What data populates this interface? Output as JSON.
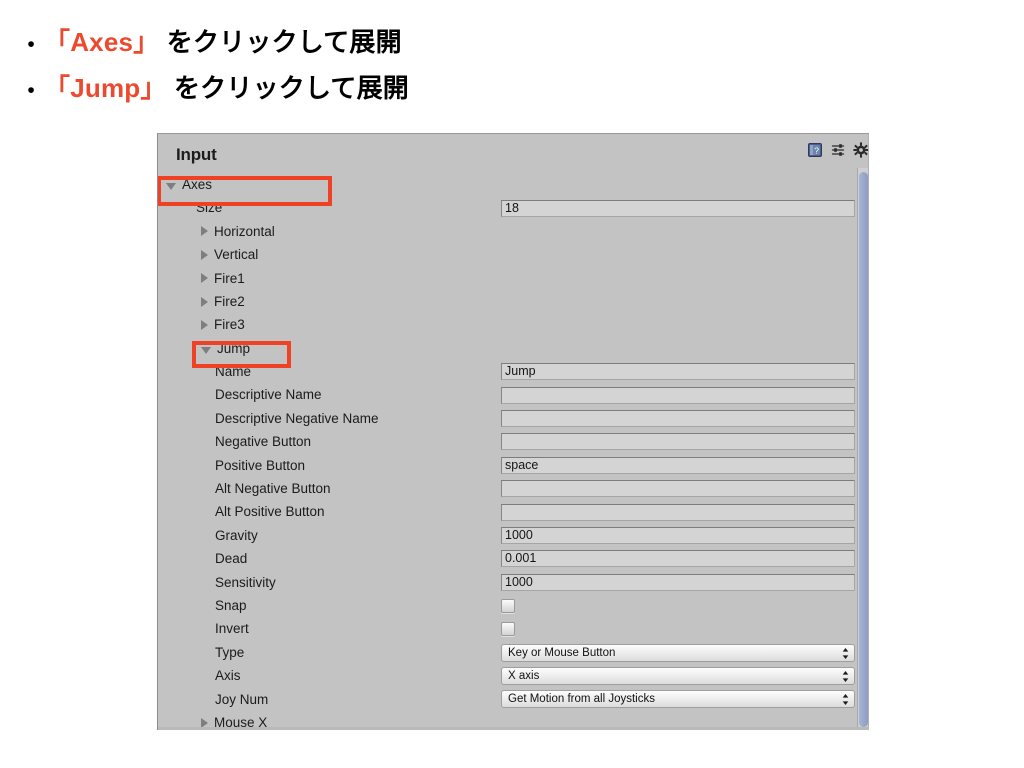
{
  "slide": {
    "bullets": [
      {
        "marker": "•",
        "prefix": "「Axes」",
        "suffix": " をクリックして展開"
      },
      {
        "marker": "•",
        "prefix": "「Jump」",
        "suffix": " をクリックして展開"
      }
    ],
    "highlight_color": "#ec4a2e"
  },
  "inspector": {
    "title": "Input",
    "header_icons": [
      {
        "name": "help-icon"
      },
      {
        "name": "preset-icon"
      },
      {
        "name": "gear-icon"
      }
    ],
    "annotation_color": "#ef4123",
    "rows": [
      {
        "name": "axes-foldout",
        "label": "Axes",
        "indent": 0,
        "toggle": "down",
        "control": "none"
      },
      {
        "name": "size-row",
        "label": "Size",
        "indent": 1,
        "toggle": "none",
        "control": "field",
        "value": "18"
      },
      {
        "name": "axis-horizontal",
        "label": "Horizontal",
        "indent": 2,
        "toggle": "right",
        "control": "none"
      },
      {
        "name": "axis-vertical",
        "label": "Vertical",
        "indent": 2,
        "toggle": "right",
        "control": "none"
      },
      {
        "name": "axis-fire1",
        "label": "Fire1",
        "indent": 2,
        "toggle": "right",
        "control": "none"
      },
      {
        "name": "axis-fire2",
        "label": "Fire2",
        "indent": 2,
        "toggle": "right",
        "control": "none"
      },
      {
        "name": "axis-fire3",
        "label": "Fire3",
        "indent": 2,
        "toggle": "right",
        "control": "none"
      },
      {
        "name": "axis-jump",
        "label": "Jump",
        "indent": 2,
        "toggle": "down",
        "control": "none"
      },
      {
        "name": "prop-name",
        "label": "Name",
        "indent": 3,
        "toggle": "none",
        "control": "field",
        "value": "Jump"
      },
      {
        "name": "prop-descriptive-name",
        "label": "Descriptive Name",
        "indent": 3,
        "toggle": "none",
        "control": "field",
        "value": ""
      },
      {
        "name": "prop-descriptive-negative-name",
        "label": "Descriptive Negative Name",
        "indent": 3,
        "toggle": "none",
        "control": "field",
        "value": ""
      },
      {
        "name": "prop-negative-button",
        "label": "Negative Button",
        "indent": 3,
        "toggle": "none",
        "control": "field",
        "value": ""
      },
      {
        "name": "prop-positive-button",
        "label": "Positive Button",
        "indent": 3,
        "toggle": "none",
        "control": "field",
        "value": "space"
      },
      {
        "name": "prop-alt-negative-button",
        "label": "Alt Negative Button",
        "indent": 3,
        "toggle": "none",
        "control": "field",
        "value": ""
      },
      {
        "name": "prop-alt-positive-button",
        "label": "Alt Positive Button",
        "indent": 3,
        "toggle": "none",
        "control": "field",
        "value": ""
      },
      {
        "name": "prop-gravity",
        "label": "Gravity",
        "indent": 3,
        "toggle": "none",
        "control": "field",
        "value": "1000"
      },
      {
        "name": "prop-dead",
        "label": "Dead",
        "indent": 3,
        "toggle": "none",
        "control": "field",
        "value": "0.001"
      },
      {
        "name": "prop-sensitivity",
        "label": "Sensitivity",
        "indent": 3,
        "toggle": "none",
        "control": "field",
        "value": "1000"
      },
      {
        "name": "prop-snap",
        "label": "Snap",
        "indent": 3,
        "toggle": "none",
        "control": "checkbox",
        "checked": false
      },
      {
        "name": "prop-invert",
        "label": "Invert",
        "indent": 3,
        "toggle": "none",
        "control": "checkbox",
        "checked": false
      },
      {
        "name": "prop-type",
        "label": "Type",
        "indent": 3,
        "toggle": "none",
        "control": "dropdown",
        "value": "Key or Mouse Button"
      },
      {
        "name": "prop-axis",
        "label": "Axis",
        "indent": 3,
        "toggle": "none",
        "control": "dropdown",
        "value": "X axis"
      },
      {
        "name": "prop-joy-num",
        "label": "Joy Num",
        "indent": 3,
        "toggle": "none",
        "control": "dropdown",
        "value": "Get Motion from all Joysticks"
      },
      {
        "name": "axis-mouse-x",
        "label": "Mouse X",
        "indent": 2,
        "toggle": "right",
        "control": "none"
      }
    ]
  }
}
